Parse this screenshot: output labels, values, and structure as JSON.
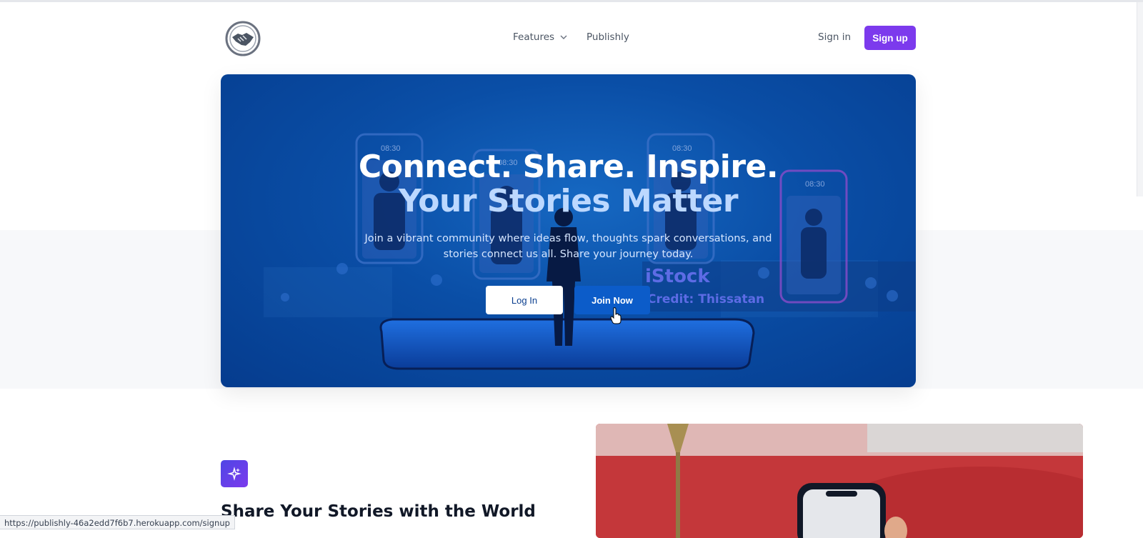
{
  "nav": {
    "logo_icon": "handshake-icon",
    "features_label": "Features",
    "features_icon": "chevron-down-icon",
    "publishly_label": "Publishly",
    "signin_label": "Sign in",
    "signup_label": "Sign up"
  },
  "hero": {
    "title_line1": "Connect. Share. Inspire.",
    "title_line2": "Your Stories Matter",
    "subtitle": "Join a vibrant community where ideas flow, thoughts spark conversations, and stories connect us all. Share your journey today.",
    "login_label": "Log In",
    "join_label": "Join Now",
    "watermark_brand": "iStock",
    "watermark_credit": "Credit: Thissatan",
    "phone_time": "08:30"
  },
  "feature": {
    "icon": "sparkles-icon",
    "title": "Share Your Stories with the World"
  },
  "status_bar": {
    "url": "https://publishly-46a2edd7f6b7.herokuapp.com/signup"
  },
  "colors": {
    "accent": "#7c3aed",
    "hero_blue": "#0a4ea6"
  }
}
